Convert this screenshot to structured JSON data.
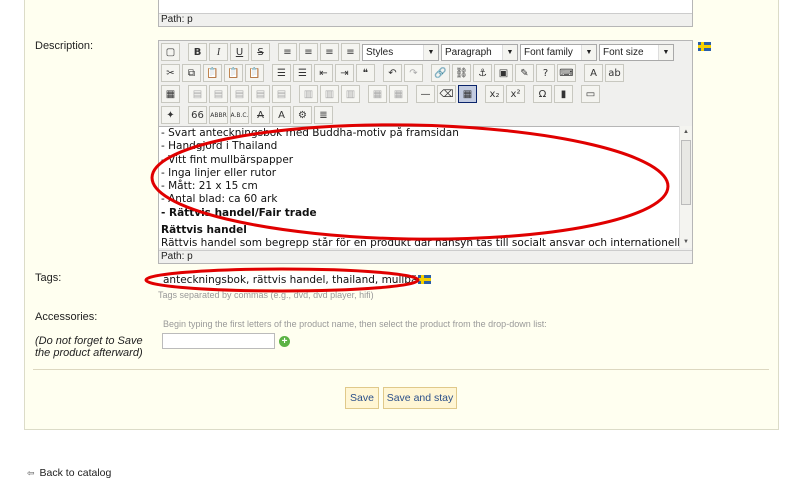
{
  "editor_top": {
    "path_label": "Path: p"
  },
  "description": {
    "label": "Description:",
    "toolbar": {
      "row1": {
        "buttons": [
          {
            "name": "new-document-icon",
            "glyph": "▢"
          },
          {
            "name": "bold-button",
            "glyph": "B"
          },
          {
            "name": "italic-button",
            "glyph": "I"
          },
          {
            "name": "underline-button",
            "glyph": "U"
          },
          {
            "name": "strikethrough-button",
            "glyph": "S"
          },
          {
            "name": "align-left-icon",
            "glyph": "≡"
          },
          {
            "name": "align-center-icon",
            "glyph": "≡"
          },
          {
            "name": "align-right-icon",
            "glyph": "≡"
          },
          {
            "name": "align-justify-icon",
            "glyph": "≡"
          }
        ],
        "styles_label": "Styles",
        "format_label": "Paragraph",
        "font_family_label": "Font family",
        "font_size_label": "Font size"
      },
      "row2": [
        {
          "name": "cut-icon",
          "glyph": "✂"
        },
        {
          "name": "copy-icon",
          "glyph": "⧉"
        },
        {
          "name": "paste-icon",
          "glyph": "📋"
        },
        {
          "name": "paste-text-icon",
          "glyph": "📋"
        },
        {
          "name": "paste-word-icon",
          "glyph": "📋"
        },
        {
          "name": "bullet-list-icon",
          "glyph": "☰"
        },
        {
          "name": "numbered-list-icon",
          "glyph": "☰"
        },
        {
          "name": "outdent-icon",
          "glyph": "⇤"
        },
        {
          "name": "indent-icon",
          "glyph": "⇥"
        },
        {
          "name": "blockquote-icon",
          "glyph": "❝"
        },
        {
          "name": "undo-icon",
          "glyph": "↶"
        },
        {
          "name": "redo-icon",
          "glyph": "↷"
        },
        {
          "name": "link-icon",
          "glyph": "🔗"
        },
        {
          "name": "unlink-icon",
          "glyph": "⛓"
        },
        {
          "name": "anchor-icon",
          "glyph": "⚓"
        },
        {
          "name": "image-icon",
          "glyph": "▣"
        },
        {
          "name": "cleanup-icon",
          "glyph": "✎"
        },
        {
          "name": "help-icon",
          "glyph": "?"
        },
        {
          "name": "code-icon",
          "glyph": "⌨"
        },
        {
          "name": "text-color-icon",
          "glyph": "A"
        },
        {
          "name": "background-color-icon",
          "glyph": "ab"
        }
      ],
      "row3": [
        {
          "name": "table-icon",
          "glyph": "▦"
        },
        {
          "name": "row-props-icon",
          "glyph": "▤"
        },
        {
          "name": "cell-props-icon",
          "glyph": "▤"
        },
        {
          "name": "insert-row-before-icon",
          "glyph": "▤"
        },
        {
          "name": "insert-row-after-icon",
          "glyph": "▤"
        },
        {
          "name": "delete-row-icon",
          "glyph": "▤"
        },
        {
          "name": "insert-col-before-icon",
          "glyph": "▥"
        },
        {
          "name": "insert-col-after-icon",
          "glyph": "▥"
        },
        {
          "name": "delete-col-icon",
          "glyph": "▥"
        },
        {
          "name": "split-cells-icon",
          "glyph": "▦"
        },
        {
          "name": "merge-cells-icon",
          "glyph": "▦"
        },
        {
          "name": "horizontal-rule-icon",
          "glyph": "—"
        },
        {
          "name": "remove-format-icon",
          "glyph": "⌫"
        },
        {
          "name": "visual-aid-icon",
          "glyph": "▦"
        },
        {
          "name": "subscript-icon",
          "glyph": "x₂"
        },
        {
          "name": "superscript-icon",
          "glyph": "x²"
        },
        {
          "name": "special-char-icon",
          "glyph": "Ω"
        },
        {
          "name": "media-icon",
          "glyph": "▮"
        },
        {
          "name": "fullscreen-icon",
          "glyph": "▭"
        }
      ],
      "row4": [
        {
          "name": "style-props-icon",
          "glyph": "✦"
        },
        {
          "name": "cite-icon",
          "glyph": "66"
        },
        {
          "name": "abbr-icon",
          "glyph": "ABBR"
        },
        {
          "name": "acronym-icon",
          "glyph": "A.B.C."
        },
        {
          "name": "delete-text-icon",
          "glyph": "A"
        },
        {
          "name": "insert-text-icon",
          "glyph": "A"
        },
        {
          "name": "attributes-icon",
          "glyph": "⚙"
        },
        {
          "name": "non-breaking-icon",
          "glyph": "≣"
        }
      ]
    },
    "content_lines": [
      "- Svart anteckningsbok med Buddha-motiv på framsidan",
      "- Handgjord i Thailand",
      "- Vitt fint mullbärspapper",
      "- Inga linjer eller rutor",
      "- Mått: 21 x 15 cm",
      "- Antal blad: ca 60 ark"
    ],
    "content_bold_line": "- Rättvis handel/Fair trade",
    "content_heading": "Rättvis handel",
    "content_cutoff": "Rättvis handel som begrepp står för en produkt där hänsyn tas till socialt ansvar och internationella Fair trade",
    "path_label": "Path: p"
  },
  "tags": {
    "label": "Tags:",
    "value": "anteckningsbok, rättvis handel, thailand, mullbärspapper",
    "hint": "Tags separated by commas (e.g., dvd, dvd player, hifi)"
  },
  "accessories": {
    "label": "Accessories:",
    "note": "(Do not forget to Save the product afterward)",
    "hint": "Begin typing the first letters of the product name, then select the product from the drop-down list:",
    "input_value": ""
  },
  "actions": {
    "save": "Save",
    "save_and_stay": "Save and stay"
  },
  "footer": {
    "back": "Back to catalog"
  },
  "colors": {
    "panel_bg": "#fffff0",
    "annotation": "#e00000",
    "button_bg": "#fff6d4",
    "link_text": "#2a4f8a"
  }
}
